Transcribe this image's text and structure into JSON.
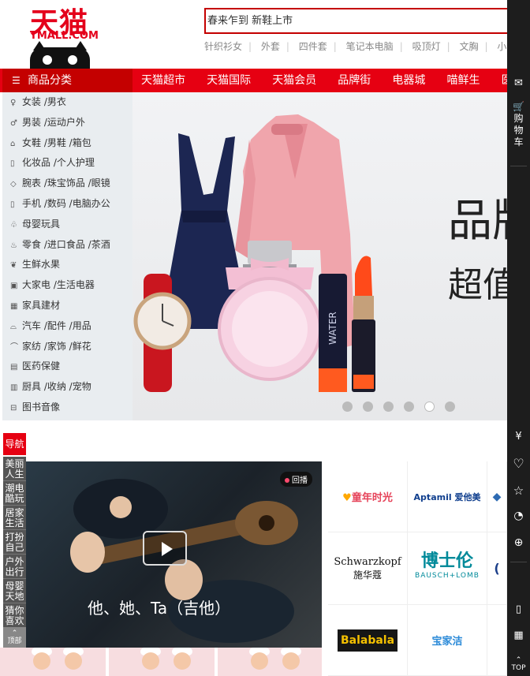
{
  "header": {
    "logo_cn": "天猫",
    "logo_en": "TMALL.COM",
    "search": {
      "value": "春来乍到 新鞋上市",
      "placeholder": ""
    },
    "hot_words": [
      "针织衫女",
      "外套",
      "四件套",
      "笔记本电脑",
      "吸顶灯",
      "文胸",
      "小白鞋"
    ]
  },
  "nav": {
    "category_label": "商品分类",
    "items": [
      "天猫超市",
      "天猫国际",
      "天猫会员",
      "品牌街",
      "电器城",
      "喵鲜生",
      "医药馆"
    ]
  },
  "categories": [
    {
      "icon": "clothing-icon",
      "glyph": "👗",
      "label": "女装 /男衣"
    },
    {
      "icon": "shirt-icon",
      "glyph": "👕",
      "label": "男装 /运动户外"
    },
    {
      "icon": "shoe-icon",
      "glyph": "👞",
      "label": "女鞋 /男鞋 /箱包"
    },
    {
      "icon": "cosmetics-icon",
      "glyph": "🧴",
      "label": "化妆品 /个人护理"
    },
    {
      "icon": "diamond-icon",
      "glyph": "💎",
      "label": "腕表 /珠宝饰品 /眼镜"
    },
    {
      "icon": "phone-icon",
      "glyph": "📱",
      "label": "手机 /数码 /电脑办公"
    },
    {
      "icon": "toy-icon",
      "glyph": "🧸",
      "label": "母婴玩具"
    },
    {
      "icon": "snack-icon",
      "glyph": "🍬",
      "label": "零食 /进口食品 /茶酒"
    },
    {
      "icon": "fruit-icon",
      "glyph": "🍎",
      "label": "生鲜水果"
    },
    {
      "icon": "appliance-icon",
      "glyph": "📺",
      "label": "大家电 /生活电器"
    },
    {
      "icon": "furniture-icon",
      "glyph": "🧱",
      "label": "家具建材"
    },
    {
      "icon": "car-icon",
      "glyph": "🚗",
      "label": "汽车 /配件 /用品"
    },
    {
      "icon": "home-textile-icon",
      "glyph": "🛏",
      "label": "家纺 /家饰 /鲜花"
    },
    {
      "icon": "medicine-icon",
      "glyph": "💊",
      "label": "医药保健"
    },
    {
      "icon": "kitchen-icon",
      "glyph": "🍳",
      "label": "厨具 /收纳 /宠物"
    },
    {
      "icon": "book-icon",
      "glyph": "📚",
      "label": "图书音像"
    }
  ],
  "banner": {
    "text_line1": "品牌",
    "text_line2": "超值",
    "lipstick_text": "WATER",
    "slide_count": 6,
    "active_slide": 5
  },
  "right_toolbar": {
    "cart_label": "购物车",
    "icons": [
      "message-icon",
      "cart-icon",
      "yen-icon",
      "heart-icon",
      "star-icon",
      "history-icon",
      "coupon-icon",
      "mobile-icon",
      "qrcode-icon",
      "top-icon"
    ],
    "top_label": "TOP"
  },
  "floor_nav": {
    "head": "导航",
    "items": [
      "美丽人生",
      "潮电酷玩",
      "居家生活",
      "打扮自己",
      "户外出行",
      "母婴天地",
      "猜你喜欢"
    ],
    "top_label": "顶部"
  },
  "video": {
    "replay_label": "回播",
    "title": "他、她、Ta（吉他）"
  },
  "brands": [
    {
      "name": "童年时光",
      "type": "tong"
    },
    {
      "name": "Aptamil 爱他美",
      "type": "apt"
    },
    {
      "name": "Schwarzkopf",
      "sub": "施华蔻",
      "type": "schw"
    },
    {
      "name": "博士伦",
      "sub": "BAUSCH+LOMB",
      "type": "bl"
    },
    {
      "name": "Balabala",
      "type": "bala"
    },
    {
      "name": "宝家洁",
      "type": "bj"
    }
  ]
}
